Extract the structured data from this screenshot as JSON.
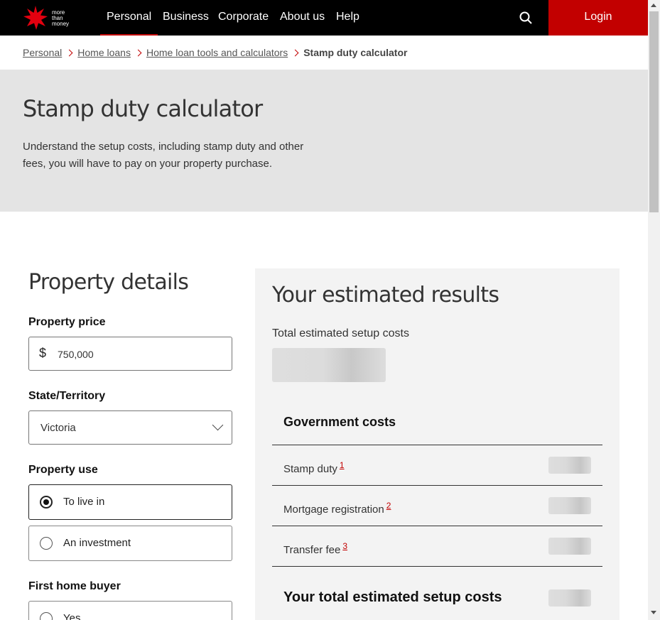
{
  "nav": {
    "logo_lines": [
      "more",
      "than",
      "money"
    ],
    "links": [
      "Personal",
      "Business",
      "Corporate",
      "About us",
      "Help"
    ],
    "login_label": "Login"
  },
  "breadcrumb": {
    "items": [
      "Personal",
      "Home loans",
      "Home loan tools and calculators"
    ],
    "current": "Stamp duty calculator"
  },
  "hero": {
    "title": "Stamp duty calculator",
    "description": "Understand the setup costs, including stamp duty and other fees, you will have to pay on your property purchase."
  },
  "form": {
    "title": "Property details",
    "price_label": "Property price",
    "currency_symbol": "$",
    "price_value": "750,000",
    "state_label": "State/Territory",
    "state_value": "Victoria",
    "use_label": "Property use",
    "use_options": [
      "To live in",
      "An investment"
    ],
    "use_selected": "To live in",
    "fhb_label": "First home buyer",
    "fhb_options": [
      "Yes"
    ]
  },
  "results": {
    "title": "Your estimated results",
    "total_label": "Total estimated setup costs",
    "gov_title": "Government costs",
    "costs": [
      {
        "label": "Stamp duty",
        "note": "1"
      },
      {
        "label": "Mortgage registration",
        "note": "2"
      },
      {
        "label": "Transfer fee",
        "note": "3"
      }
    ],
    "final_label": "Your total estimated setup costs"
  },
  "colors": {
    "brand_red": "#c20000",
    "nav_bg": "#000000",
    "hero_bg": "#e4e4e4",
    "panel_bg": "#f3f3f3"
  }
}
